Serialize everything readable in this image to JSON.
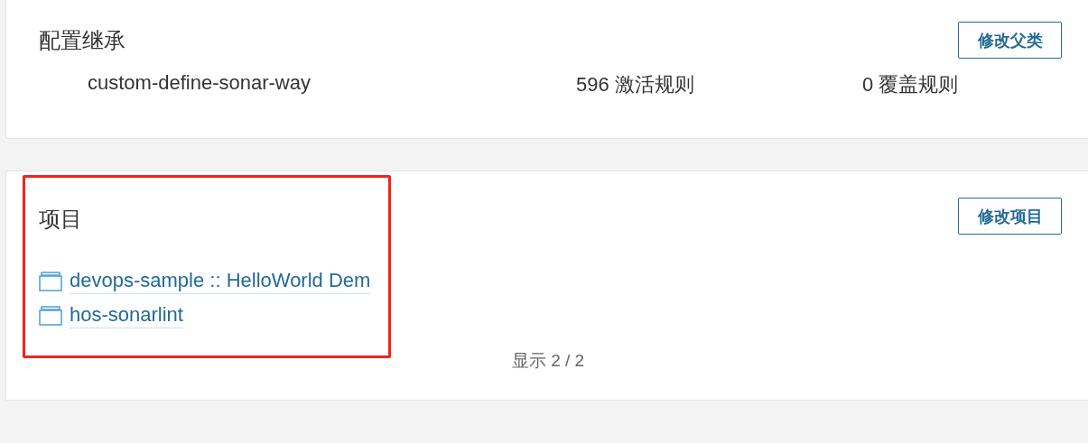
{
  "inheritance": {
    "title": "配置继承",
    "button": "修改父类",
    "profile": {
      "name": "custom-define-sonar-way",
      "active_rules": "596 激活规则",
      "overriding_rules": "0 覆盖规则"
    }
  },
  "projects": {
    "title": "项目",
    "button": "修改项目",
    "items": [
      {
        "name": "devops-sample :: HelloWorld Dem"
      },
      {
        "name": "hos-sonarlint"
      }
    ],
    "footer": "显示 2 / 2"
  }
}
